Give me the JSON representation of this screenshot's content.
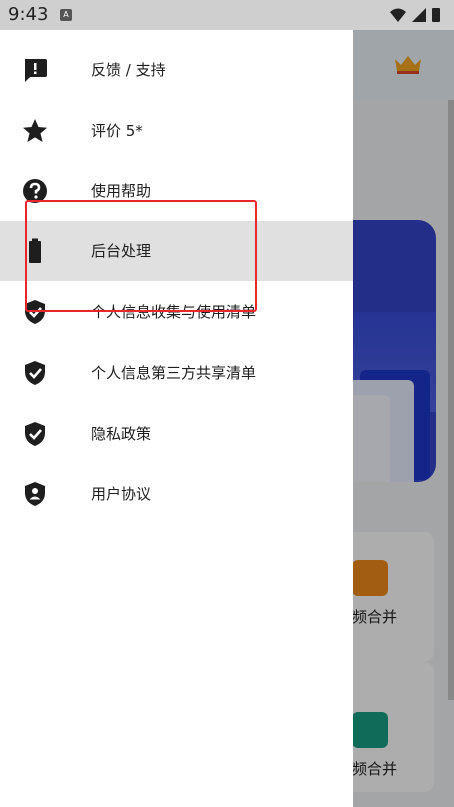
{
  "status_bar": {
    "time": "9:43",
    "badge": "A"
  },
  "drawer": {
    "items": [
      {
        "label": "反馈 / 支持",
        "icon": "feedback-icon"
      },
      {
        "label": "评价 5*",
        "icon": "star-icon"
      },
      {
        "label": "使用帮助",
        "icon": "help-icon"
      },
      {
        "label": "后台处理",
        "icon": "battery-icon",
        "active": true
      },
      {
        "label": "个人信息收集与使用清单",
        "icon": "shield-check-icon"
      },
      {
        "label": "个人信息第三方共享清单",
        "icon": "shield-check-icon"
      },
      {
        "label": "隐私政策",
        "icon": "shield-check-icon"
      },
      {
        "label": "用户协议",
        "icon": "shield-user-icon"
      }
    ]
  },
  "background_app": {
    "card1_label": "频合并",
    "card2_label": "频合并"
  },
  "colors": {
    "highlight": "#e8262c",
    "active_row": "#e0e0e0",
    "crown": "#f5a623"
  }
}
